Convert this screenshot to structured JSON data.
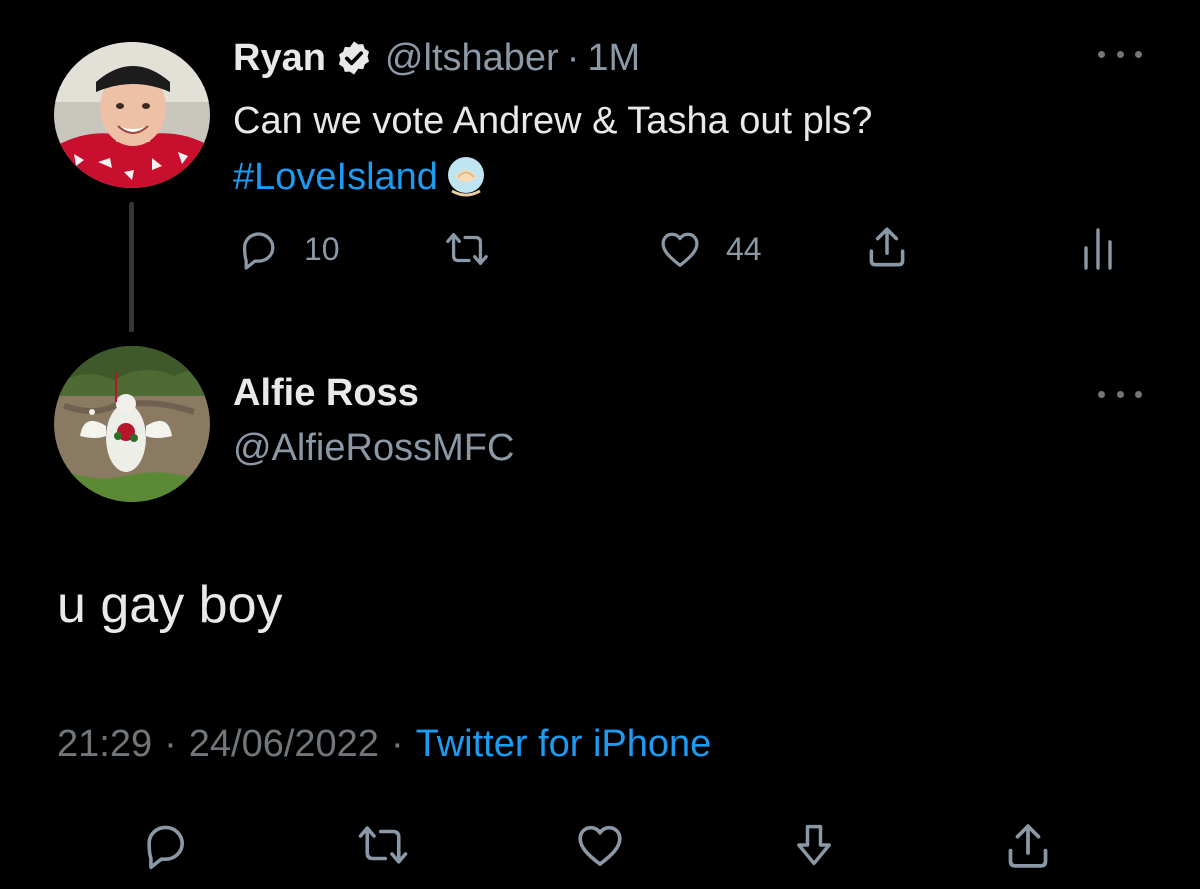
{
  "parent_tweet": {
    "display_name": "Ryan",
    "handle": "@ltshaber",
    "separator": "·",
    "time": "1M",
    "text": "Can we vote Andrew & Tasha out pls?",
    "hashtag": "#LoveIsland",
    "reply_count": "10",
    "like_count": "44",
    "icons": [
      "verified-badge-icon",
      "more-options-icon",
      "reply-icon",
      "retweet-icon",
      "like-icon",
      "share-icon",
      "view-stats-icon"
    ]
  },
  "reply_tweet": {
    "display_name": "Alfie Ross",
    "handle": "@AlfieRossMFC",
    "text": "u gay boy",
    "time": "21:29",
    "date": "24/06/2022",
    "separator": "·",
    "source": "Twitter for iPhone",
    "icons": [
      "more-options-icon",
      "reply-icon",
      "retweet-icon",
      "like-icon",
      "bookmark-icon",
      "share-icon"
    ]
  },
  "colors": {
    "background": "#000000",
    "primary_text": "#e7e9ea",
    "secondary_text": "#8b98a5",
    "link": "#1d9bf0",
    "verified": "#e7e9ea"
  }
}
